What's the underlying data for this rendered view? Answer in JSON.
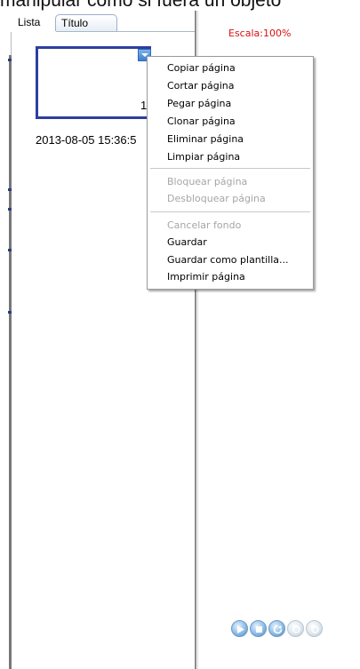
{
  "top_caption": "manipular como si fuera un objeto",
  "tabs": [
    {
      "label": "Lista"
    },
    {
      "label": "Título"
    }
  ],
  "page_list": {
    "page_number": "1",
    "timestamp": "2013-08-05 15:36:5"
  },
  "canvas": {
    "scale_label": "Escala:100%"
  },
  "context_menu": {
    "groups": [
      [
        {
          "label": "Copiar página",
          "enabled": true
        },
        {
          "label": "Cortar página",
          "enabled": true
        },
        {
          "label": "Pegar página",
          "enabled": true
        },
        {
          "label": "Clonar página",
          "enabled": true
        },
        {
          "label": "Eliminar página",
          "enabled": true
        },
        {
          "label": "Limpiar página",
          "enabled": true
        }
      ],
      [
        {
          "label": "Bloquear página",
          "enabled": false
        },
        {
          "label": "Desbloquear página",
          "enabled": false
        }
      ],
      [
        {
          "label": "Cancelar fondo",
          "enabled": false
        },
        {
          "label": "Guardar",
          "enabled": true
        },
        {
          "label": "Guardar como plantilla...",
          "enabled": true
        },
        {
          "label": "Imprimir página",
          "enabled": true
        }
      ]
    ]
  },
  "playback_controls": [
    {
      "icon": "play-icon"
    },
    {
      "icon": "stop-icon"
    },
    {
      "icon": "refresh-icon"
    },
    {
      "icon": "back-icon"
    },
    {
      "icon": "next-icon"
    }
  ],
  "colors": {
    "scale_text": "#d81010",
    "thumbnail_border": "#2d3ea0",
    "disabled_text": "#a6a6a6"
  }
}
